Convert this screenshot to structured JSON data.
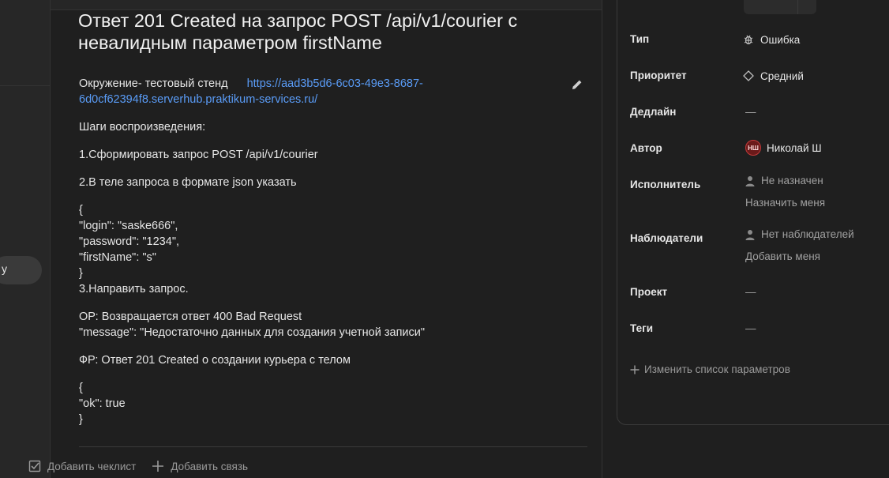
{
  "left_rail": {
    "pill_label": "y"
  },
  "issue": {
    "title": "Ответ 201 Created на запрос POST /api/v1/courier с невалидным параметром firstName",
    "description": {
      "env_label": "Окружение- тестовый стенд",
      "env_link": "https://aad3b5d6-6c03-49e3-8687-6d0cf62394f8.serverhub.praktikum-services.ru/",
      "steps_title": "Шаги воспроизведения:",
      "step1": "1.Сформировать запрос POST /api/v1/courier",
      "step2": "2.В теле запроса в формате json указать",
      "body_json": "{\n\"login\": \"saske666\",\n\"password\": \"1234\",\n\"firstName\": \"s\"\n}\n3.Направить запрос.",
      "expected": "ОР: Возвращается ответ 400 Bad Request\n\"message\": \"Недостаточно данных для создания учетной записи\"",
      "actual": "ФР: Ответ 201 Created о создании курьера с телом",
      "actual_body": "{\n\"ok\": true\n}"
    },
    "footer": {
      "add_checklist": "Добавить чеклист",
      "add_link": "Добавить связь"
    }
  },
  "sidebar": {
    "type_label": "Тип",
    "type_value": "Ошибка",
    "type_icon": "bug-icon",
    "priority_label": "Приоритет",
    "priority_value": "Средний",
    "priority_icon": "diamond-icon",
    "deadline_label": "Дедлайн",
    "deadline_value": "—",
    "author_label": "Автор",
    "author_avatar": "НШ",
    "author_name": "Николай Ш",
    "assignee_label": "Исполнитель",
    "assignee_value": "Не назначен",
    "assign_me": "Назначить меня",
    "watchers_label": "Наблюдатели",
    "watchers_value": "Нет наблюдателей",
    "add_me": "Добавить меня",
    "project_label": "Проект",
    "project_value": "—",
    "tags_label": "Теги",
    "tags_value": "—",
    "change_params": "Изменить список параметров"
  },
  "colors": {
    "background": "#1f1f1f",
    "link": "#5a9cf7",
    "avatar_bg": "#6b1a1a",
    "avatar_border": "#c23a3a"
  }
}
